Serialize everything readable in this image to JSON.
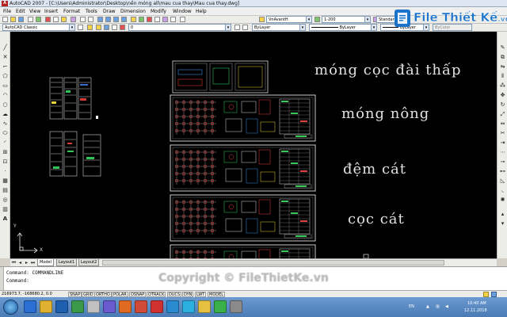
{
  "window": {
    "title": "AutoCAD 2007 - [C:\\Users\\Administrator\\Desktop\\nền móng all\\mau cua thay\\Mau cua thay.dwg]",
    "app_icon": "A"
  },
  "menu": [
    "File",
    "Edit",
    "View",
    "Insert",
    "Format",
    "Tools",
    "Draw",
    "Dimension",
    "Modify",
    "Window",
    "Help"
  ],
  "toolbar": {
    "text_style": "VnAvantH",
    "dim_scale": "1-200",
    "dim_style": "Standard",
    "workspace": "AutoCAD Classic",
    "layer_value": "0",
    "color_control": "ByLayer",
    "linetype_control": "ByLayer",
    "lineweight_control": "ByLayer",
    "plotstyle_control": "ByColor"
  },
  "drawing": {
    "annotations": [
      "móng cọc đài thấp",
      "móng nông",
      "đệm cát",
      "cọc cát"
    ],
    "ucs_x": "X",
    "ucs_y": "Y"
  },
  "tabs": [
    "Model",
    "Layout1",
    "Layout2"
  ],
  "command": {
    "line1": "Command: COMMANDLINE",
    "line2": "Command:"
  },
  "status": {
    "coords": "216973.7, -168680.2, 0.0",
    "buttons": [
      "SNAP",
      "GRID",
      "ORTHO",
      "POLAR",
      "OSNAP",
      "OTRACK",
      "DUCS",
      "DYN",
      "LWT",
      "MODEL"
    ]
  },
  "taskbar": {
    "apps": [
      "",
      "",
      "",
      "",
      "",
      "",
      "",
      "",
      "",
      "",
      "",
      "",
      "",
      ""
    ],
    "language": "EN",
    "time": "10:40 AM",
    "date": "12.11.2018"
  },
  "watermark": {
    "logo_text": "File Thiết Kế",
    "logo_suffix": ".vn",
    "copyright": "Copyright © FileThietKe.vn"
  },
  "colors": {
    "canvas": "#000000",
    "accent": "#1b74c9"
  }
}
